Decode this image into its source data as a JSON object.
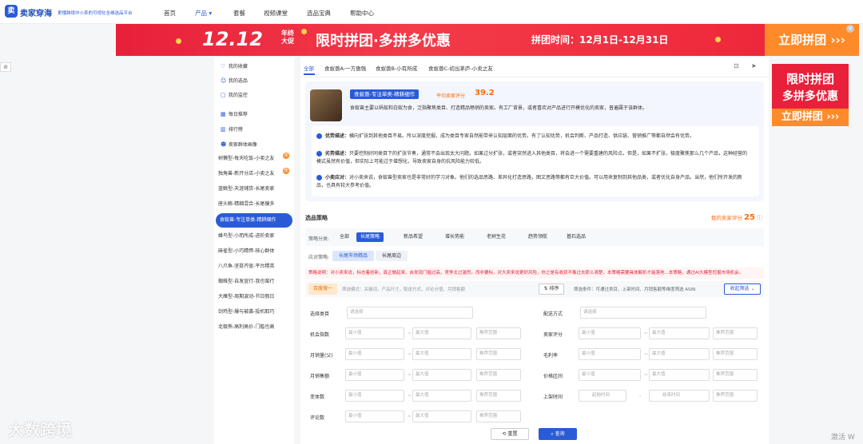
{
  "nav": {
    "brand": "卖家穿海",
    "slogan": "更懂跨境中小卖的可视化全维选品平台",
    "items": [
      "首页",
      "产品 ▾",
      "套餐",
      "视频课堂",
      "选品宝典",
      "帮助中心"
    ]
  },
  "banner": {
    "d1212": "12.12",
    "yr": "年终大促",
    "main": "限时拼团·多拼多优惠",
    "time": "拼团时间：12月1日-12月31日",
    "btn": "立即拼团 ›››",
    "close": "✕"
  },
  "sidebar": {
    "items": [
      "我的收藏",
      "我的选品",
      "我的监控",
      "每日推荐",
      "排行榜",
      "卖家群体画像",
      "树懒型-每天吃饭-小卖之友",
      "独角兽-新开分店-小卖之友",
      "蓝鲸型-天涯铺货-长尾卖家",
      "座头鲸-精细混合-长尾偏多",
      "食蚁兽-专注单类-精耕细作",
      "蜂鸟型-小而所成-进阶卖家",
      "麻雀型-小巧精悍-核心群体",
      "八爪鱼-坚挺齐驱-平台精英",
      "蜘蛛型-自发宣行-我也蛮行",
      "大雁型-周期波动-节日假日",
      "剑鸡型-爆与被袭-投机取巧",
      "北极熊-高利高价-门槛也高"
    ]
  },
  "tabs": [
    "全部",
    "食蚁兽A-一方傲强",
    "食蚁兽B-小有所成",
    "食蚁兽C-初出茅庐-小卖之友"
  ],
  "card": {
    "tag": "食蚁兽-专注单类-精耕细作",
    "score_label": "平均卖家评分",
    "score": "39.2",
    "desc": "食蚁兽主要以蚂蚁和白蚁为食，泛指聚焦类目、打造精品畅销的卖家。有工厂背景，或者喜欢对产品进行开模优化的卖家，普遍属于该群体。",
    "adv_t": "优势描述：",
    "adv": "横向扩张到其他类目不易。所以深度挖掘，成为类目专家自然能带来认知层面的优势。有了认知优势，机会判断、产品打造、供应链、营销推广等都自然会有优势。",
    "dis_t": "劣势描述：",
    "dis": "只要控制好同类目下的扩张节奏，通常不会出现太大问题。如果过分扩张，或者突然进入其他类目，将会进一个需要重建的风险点。但是，如果不扩张，极度聚焦那么几个产品，这种经营的模式虽然有价值，但实际上可能过于增想化，导致卖家自身的抗风险能力较低。",
    "tip_t": "小卖应对：",
    "tip": "对小卖来说，食蚁兽型卖家也是非常好的学习对象。他们的选品思路、差异化打造思路，图文思路等都有巨大价值。可以用来复制到其他品类，或者优化自身产品。当然，他们所开发的新品，也具有较大参考价值。"
  },
  "strategy": {
    "title": "选品策略",
    "myscore_label": "我的卖家评分",
    "myscore": "25",
    "cat_label": "策略分类:",
    "cats": [
      "全部",
      "长尾策略",
      "新品希望",
      "增长势能",
      "老树生花",
      "趋势领航",
      "基石选品"
    ],
    "sub_label": "应对策略:",
    "subs": [
      "长尾市场精品",
      "长尾周边"
    ],
    "warn": "策略说明：对小卖来说，标志着创新，真正做起来，自发现门槛过高，竞争太过激烈。而非要标，对大卖来说更好风险，你之是有收获不像过去那么清楚，本策略需要具体解析才能落地...本策略，通过AI大模型挖掘市场机会。",
    "kw": "百度搜一",
    "kw_ph": "筛选模式：关键词，产品尺寸，配送方式，评论分值，月销售额",
    "sort": "⇅ 排序",
    "filter": "筛选条件：可通过类目、上架时间、月销售额等维度筛选 ASIN",
    "collapse": "收起筛选 ⌄"
  },
  "form": {
    "cat": "选择类目",
    "cat_ph": "请选择",
    "ship": "配送方式",
    "ship_ph": "请选择",
    "opp": "机会指数",
    "seller": "卖家评分",
    "msv": "月销量(父)",
    "gm": "毛利率",
    "msa": "月销售额",
    "price": "价格区间",
    "rev": "变体数",
    "date": "上架时间",
    "revnum": "评论数",
    "min": "最小值",
    "max": "最大值",
    "range": "推荐范围",
    "start": "起始时间",
    "end": "结束时间"
  },
  "buttons": {
    "reset": "⟲ 重置",
    "search": "⌕ 查询"
  },
  "ad": {
    "t1": "限时拼团",
    "t2": "多拼多优惠",
    "btn": "立即拼团 ›››"
  },
  "wm": "大数跨境",
  "wm2": "激活 W"
}
